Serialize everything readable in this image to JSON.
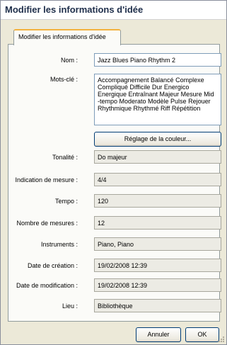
{
  "dialog": {
    "title": "Modifier les informations d'idée"
  },
  "tab": {
    "label": "Modifier les informations d'idée"
  },
  "fields": {
    "nom": {
      "label": "Nom :",
      "value": "Jazz Blues Piano Rhythm 2"
    },
    "mots_cle": {
      "label": "Mots-clé :",
      "value": "Accompagnement Balancé Complexe Compliqué Difficile Dur Energico Energique Entraînant Majeur Mesure Mid -tempo Moderato Modèle Pulse Rejouer Rhythmique Rhythmé Riff Répétition"
    },
    "tonalite": {
      "label": "Tonalité :",
      "value": "Do majeur"
    },
    "mesure": {
      "label": "Indication de mesure :",
      "value": "4/4"
    },
    "tempo": {
      "label": "Tempo :",
      "value": "120"
    },
    "nb_mesures": {
      "label": "Nombre de mesures :",
      "value": "12"
    },
    "instruments": {
      "label": "Instruments :",
      "value": "Piano, Piano"
    },
    "creation": {
      "label": "Date de création :",
      "value": "19/02/2008 12:39"
    },
    "modification": {
      "label": "Date de modification :",
      "value": "19/02/2008 12:39"
    },
    "lieu": {
      "label": "Lieu :",
      "value": "Bibliothèque"
    }
  },
  "buttons": {
    "color": "Réglage de la couleur...",
    "cancel": "Annuler",
    "ok": "OK"
  }
}
